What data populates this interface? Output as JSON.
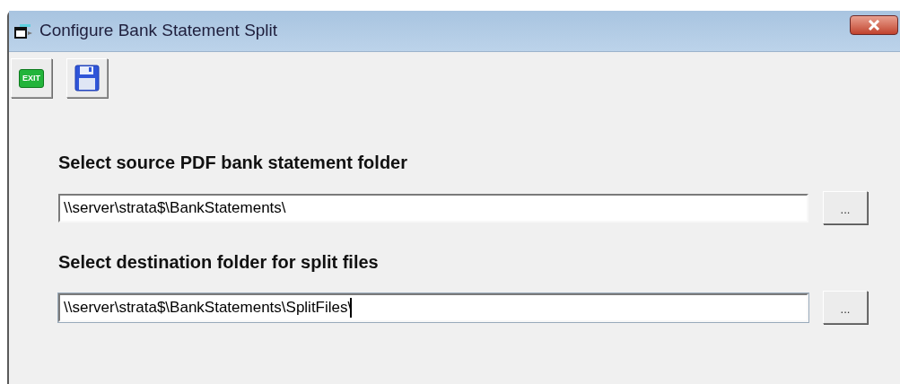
{
  "window": {
    "title": "Configure Bank Statement Split"
  },
  "toolbar": [
    {
      "kind": "exit",
      "label": "EXIT"
    },
    {
      "kind": "save"
    }
  ],
  "sections": [
    {
      "heading": "Select source PDF bank statement folder",
      "path": "\\\\server\\strata$\\BankStatements\\",
      "focused": false,
      "browse": "..."
    },
    {
      "heading": "Select destination folder for split files",
      "path": "\\\\server\\strata$\\BankStatements\\SplitFiles\\",
      "focused": true,
      "browse": "..."
    }
  ]
}
